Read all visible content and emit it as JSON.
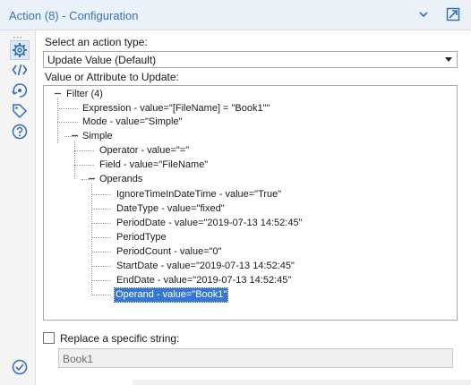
{
  "window": {
    "title": "Action (8) - Configuration"
  },
  "sidebar": {
    "more": "⋯",
    "icons": [
      "gear-icon",
      "code-icon",
      "connections-icon",
      "tag-icon",
      "help-icon",
      "check-circle-icon"
    ],
    "active": "gear-icon"
  },
  "form": {
    "action_type_label": "Select an action type:",
    "action_type_value": "Update Value (Default)",
    "tree_label": "Value or Attribute to Update:",
    "replace_label": "Replace a specific string:",
    "replace_checked": false,
    "replace_value": "Book1"
  },
  "tree": {
    "n0": "Filter (4)",
    "n1": "Expression - value=\"[FileName] = \"Book1\"\"",
    "n2": "Mode - value=\"Simple\"",
    "n3": "Simple",
    "n4": "Operator - value=\"=\"",
    "n5": "Field - value=\"FileName\"",
    "n6": "Operands",
    "n7": "IgnoreTimeInDateTime - value=\"True\"",
    "n8": "DateType - value=\"fixed\"",
    "n9": "PeriodDate - value=\"2019-07-13 14:52:45\"",
    "n10": "PeriodType",
    "n11": "PeriodCount - value=\"0\"",
    "n12": "StartDate - value=\"2019-07-13 14:52:45\"",
    "n13": "EndDate - value=\"2019-07-13 14:52:45\"",
    "n14": "Operand - value=\"Book1\"",
    "selected": "n14"
  },
  "colors": {
    "title": "#3a73b8",
    "accent": "#2f6fb6",
    "selection": "#3478d4",
    "header_bg": "#eaf1f8"
  }
}
